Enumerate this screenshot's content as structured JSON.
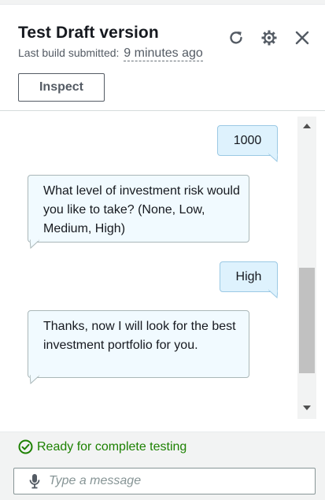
{
  "header": {
    "title": "Test Draft version",
    "subtitle_label": "Last build submitted:",
    "subtitle_time": "9 minutes ago",
    "inspect_label": "Inspect",
    "icons": [
      "refresh-icon",
      "settings-icon",
      "close-icon"
    ]
  },
  "messages": [
    {
      "role": "user",
      "text": "1000"
    },
    {
      "role": "bot",
      "text": "What level of investment risk would you like to take? (None, Low, Medium, High)"
    },
    {
      "role": "user",
      "text": "High"
    },
    {
      "role": "bot",
      "text": "Thanks, now I will look for the best investment portfolio for you."
    }
  ],
  "footer": {
    "status_text": "Ready for complete testing",
    "input_placeholder": "Type a message",
    "input_value": ""
  },
  "colors": {
    "status_green": "#1d8102",
    "user_bubble": "#def2fd",
    "bot_bubble": "#f1faff"
  }
}
